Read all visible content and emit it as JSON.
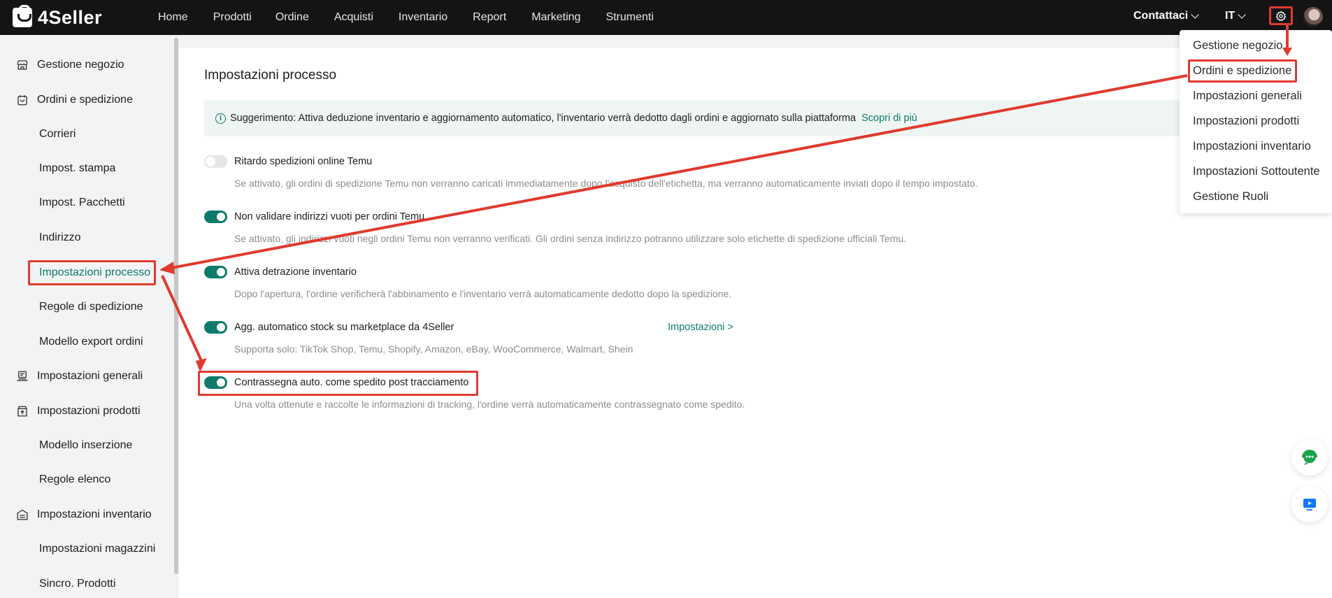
{
  "app": {
    "name": "4Seller"
  },
  "topnav": {
    "items": [
      "Home",
      "Prodotti",
      "Ordine",
      "Acquisti",
      "Inventario",
      "Report",
      "Marketing",
      "Strumenti"
    ],
    "contact_label": "Contattaci",
    "language": "IT"
  },
  "sidebar": {
    "items": [
      {
        "label": "Gestione negozio",
        "icon": "store-icon",
        "level": 1
      },
      {
        "label": "Ordini e spedizione",
        "icon": "bag-icon",
        "level": 1
      },
      {
        "label": "Corrieri",
        "level": 2
      },
      {
        "label": "Impost. stampa",
        "level": 2
      },
      {
        "label": "Impost. Pacchetti",
        "level": 2
      },
      {
        "label": "Indirizzo",
        "level": 2
      },
      {
        "label": "Impostazioni processo",
        "level": 2,
        "active": true
      },
      {
        "label": "Regole di spedizione",
        "level": 2
      },
      {
        "label": "Modello export ordini",
        "level": 2
      },
      {
        "label": "Impostazioni generali",
        "icon": "keyboard-icon",
        "level": 1
      },
      {
        "label": "Impostazioni prodotti",
        "icon": "box-upload-icon",
        "level": 1
      },
      {
        "label": "Modello inserzione",
        "level": 2
      },
      {
        "label": "Regole elenco",
        "level": 2
      },
      {
        "label": "Impostazioni inventario",
        "icon": "inventory-icon",
        "level": 1
      },
      {
        "label": "Impostazioni magazzini",
        "level": 2
      },
      {
        "label": "Sincro. Prodotti",
        "level": 2
      }
    ]
  },
  "main": {
    "title": "Impostazioni processo",
    "tip": {
      "text": "Suggerimento: Attiva deduzione inventario e aggiornamento automatico, l'inventario verrà dedotto dagli ordini e aggiornato sulla piattaforma",
      "link": "Scopri di più"
    },
    "settings": [
      {
        "label": "Ritardo spedizioni online Temu",
        "enabled": false,
        "desc": "Se attivato, gli ordini di spedizione Temu non verranno caricati immediatamente dopo l'acquisto dell'etichetta, ma verranno automaticamente inviati dopo il tempo impostato."
      },
      {
        "label": "Non validare indirizzi vuoti per ordini Temu",
        "enabled": true,
        "desc": "Se attivato, gli indirizzi vuoti negli ordini Temu non verranno verificati. Gli ordini senza indirizzo potranno utilizzare solo etichette di spedizione ufficiali Temu."
      },
      {
        "label": "Attiva detrazione inventario",
        "enabled": true,
        "desc": "Dopo l'apertura, l'ordine verificherà l'abbinamento e l'inventario verrà automaticamente dedotto dopo la spedizione."
      },
      {
        "label": "Agg. automatico stock su marketplace da 4Seller",
        "enabled": true,
        "desc": "Supporta solo: TikTok Shop, Temu, Shopify, Amazon, eBay, WooCommerce, Walmart, Shein",
        "link": "Impostazioni >"
      },
      {
        "label": "Contrassegna auto. come spedito post tracciamento",
        "enabled": true,
        "desc": "Una volta ottenute e raccolte le informazioni di tracking, l'ordine verrà automaticamente contrassegnato come spedito."
      }
    ]
  },
  "settings_menu": {
    "items": [
      "Gestione negozio",
      "Ordini e spedizione",
      "Impostazioni generali",
      "Impostazioni prodotti",
      "Impostazioni inventario",
      "Impostazioni Sottoutente",
      "Gestione Ruoli"
    ],
    "highlighted": "Ordini e spedizione"
  },
  "colors": {
    "accent": "#0d7b6a",
    "annotation": "#e03a2f",
    "topbar": "#141414"
  }
}
